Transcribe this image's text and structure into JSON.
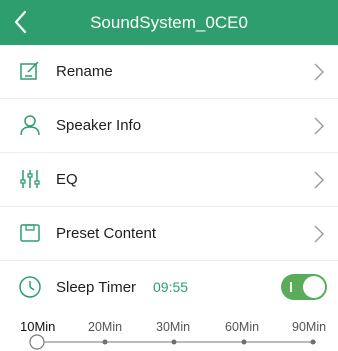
{
  "header": {
    "title": "SoundSystem_0CE0",
    "back_icon": "chevron-left-icon",
    "color": "#2e9e6e"
  },
  "menu": {
    "items": [
      {
        "label": "Rename",
        "icon": "edit-icon"
      },
      {
        "label": "Speaker Info",
        "icon": "person-icon"
      },
      {
        "label": "EQ",
        "icon": "equalizer-icon"
      },
      {
        "label": "Preset Content",
        "icon": "preset-icon"
      }
    ],
    "chevron_icon": "chevron-right-icon"
  },
  "sleep_timer": {
    "label": "Sleep Timer",
    "time": "09:55",
    "icon": "clock-icon",
    "enabled": true,
    "toggle_color": "#5aab5a"
  },
  "slider": {
    "options": [
      "10Min",
      "20Min",
      "30Min",
      "60Min",
      "90Min"
    ],
    "selected": "10Min"
  }
}
